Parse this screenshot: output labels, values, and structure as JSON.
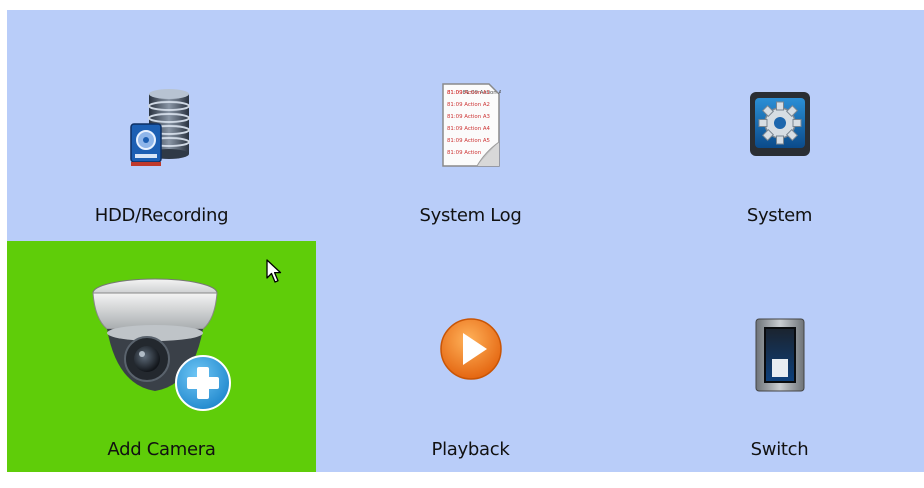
{
  "menu": {
    "items": [
      {
        "label": "HDD/Recording",
        "icon": "hdd-database-icon",
        "selected": false
      },
      {
        "label": "System Log",
        "icon": "system-log-document-icon",
        "selected": false
      },
      {
        "label": "System",
        "icon": "gear-settings-icon",
        "selected": false
      },
      {
        "label": "Add Camera",
        "icon": "dome-camera-add-icon",
        "selected": true
      },
      {
        "label": "Playback",
        "icon": "play-icon",
        "selected": false
      },
      {
        "label": "Switch",
        "icon": "power-switch-icon",
        "selected": false
      }
    ],
    "log_lines": [
      "81:09 Action A1",
      "81:09 Action A2",
      "81:09 Action A3",
      "81:09 Action A4",
      "81:09 Action A5",
      "81:09 Action"
    ]
  },
  "colors": {
    "background": "#b9cdf9",
    "selected": "#5fcd09",
    "play": "#f07a14"
  }
}
